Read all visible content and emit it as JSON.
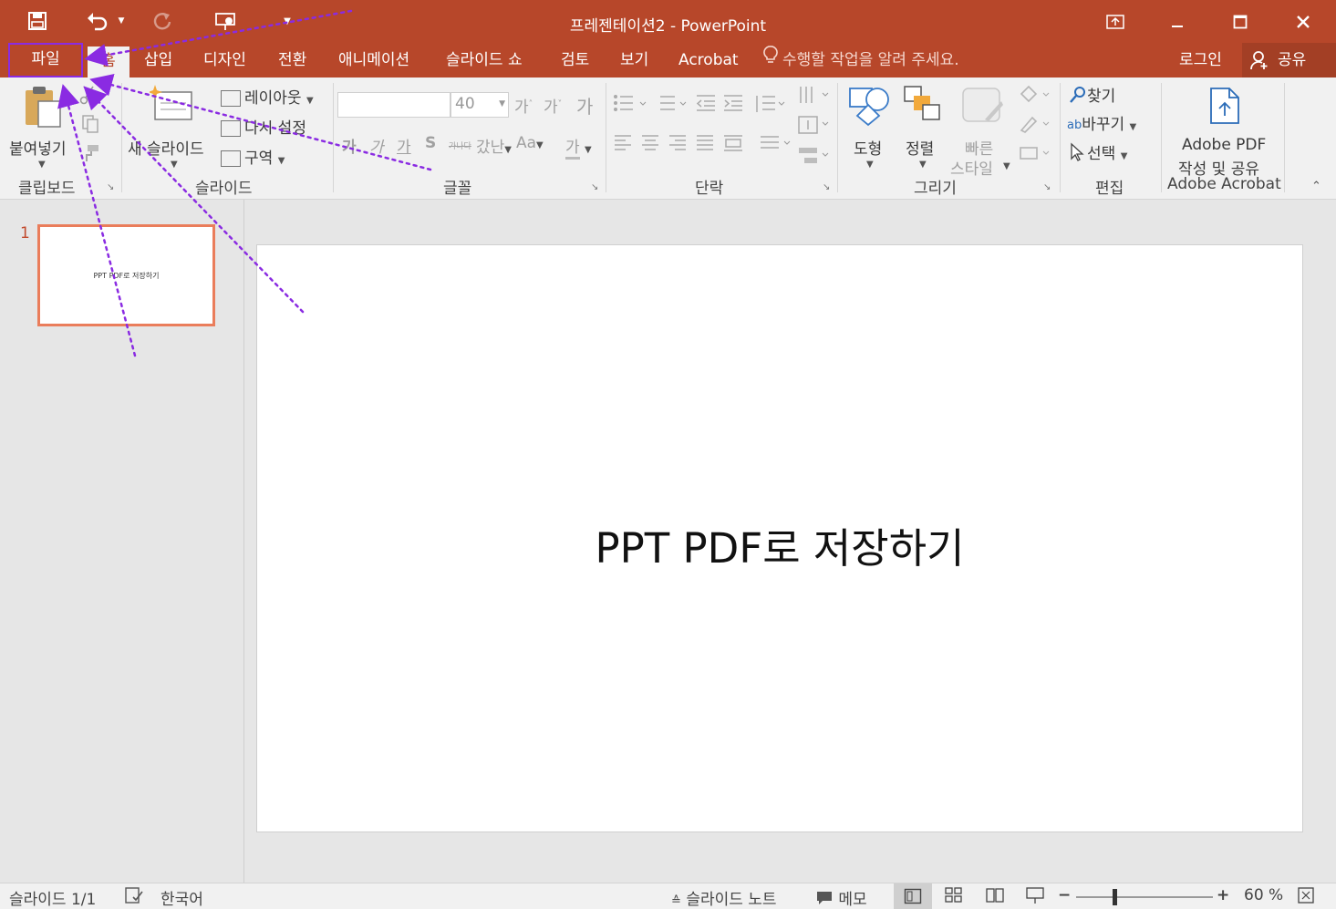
{
  "window": {
    "title": "프레젠테이션2 - PowerPoint",
    "sign_in": "로그인",
    "share": "공유"
  },
  "tabs": {
    "file": "파일",
    "home": "홈",
    "insert": "삽입",
    "design": "디자인",
    "transitions": "전환",
    "animations": "애니메이션",
    "slideshow": "슬라이드 쇼",
    "review": "검토",
    "view": "보기",
    "acrobat": "Acrobat"
  },
  "tell_me": "수행할 작업을 알려 주세요.",
  "ribbon": {
    "clipboard": {
      "paste": "붙여넣기",
      "label": "클립보드"
    },
    "slides": {
      "new_slide": "새 슬라이드",
      "layout": "레이아웃",
      "reset": "다시 설정",
      "section": "구역",
      "label": "슬라이드"
    },
    "font": {
      "size": "40",
      "grow": "가",
      "shrink": "가",
      "bold": "가",
      "italic": "가",
      "underline": "가",
      "shadow": "S",
      "strike": "가나다",
      "spacing": "갔난",
      "case": "Aa",
      "color": "가",
      "label": "글꼴"
    },
    "paragraph": {
      "label": "단락"
    },
    "drawing": {
      "shapes": "도형",
      "arrange": "정렬",
      "quick_styles_1": "빠른",
      "quick_styles_2": "스타일",
      "label": "그리기"
    },
    "editing": {
      "find": "찾기",
      "replace": "바꾸기",
      "select": "선택",
      "label": "편집"
    },
    "acrobat": {
      "create_1": "Adobe PDF",
      "create_2": "작성 및 공유",
      "label": "Adobe Acrobat"
    }
  },
  "thumbnail": {
    "number": "1",
    "title": "PPT PDF로 저장하기"
  },
  "slide": {
    "title": "PPT PDF로 저장하기"
  },
  "status": {
    "slide_count": "슬라이드 1/1",
    "language": "한국어",
    "notes": "슬라이드 노트",
    "comments": "메모",
    "zoom": "60 %"
  },
  "colors": {
    "accent": "#b7472a",
    "annotation": "#8a2be2",
    "thumb_border": "#ea7d5b"
  },
  "icons": [
    "save-icon",
    "undo-icon",
    "redo-icon",
    "present-icon",
    "restore-ribbon-icon",
    "minimize-icon",
    "maximize-icon",
    "close-icon",
    "lightbulb-icon",
    "user-icon",
    "paste-icon",
    "cut-icon",
    "copy-icon",
    "format-painter-icon",
    "new-slide-icon",
    "find-icon",
    "adobe-pdf-icon"
  ]
}
